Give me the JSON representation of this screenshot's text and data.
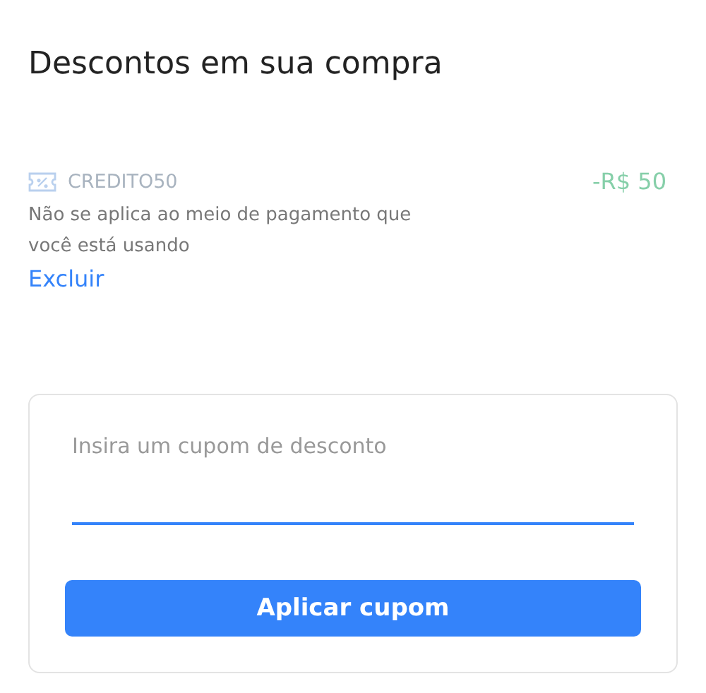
{
  "title": "Descontos em sua compra",
  "coupons": [
    {
      "code": "CREDITO50",
      "amount": "-R$ 50",
      "disabled": true,
      "message": "Não se aplica ao meio de pagamento que você está usando",
      "action": "Excluir"
    }
  ],
  "coupon_form": {
    "placeholder": "Insira um cupom de desconto",
    "button": "Aplicar cupom"
  }
}
